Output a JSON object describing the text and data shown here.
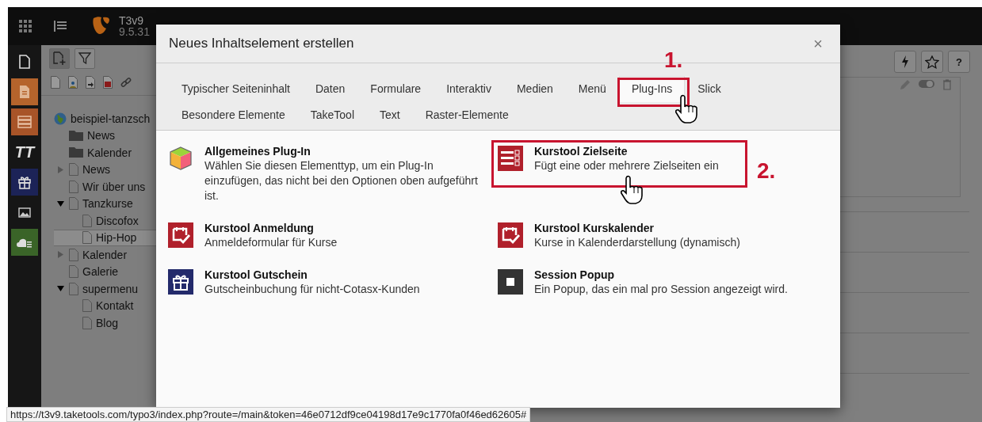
{
  "topbar": {
    "app_name": "T3v9",
    "version": "9.5.31"
  },
  "module_menu": [
    {
      "kind": "page"
    },
    {
      "kind": "content",
      "color": "#b5642c"
    },
    {
      "kind": "list",
      "color": "#a85428"
    },
    {
      "kind": "logo",
      "label": "TT"
    },
    {
      "kind": "gift",
      "color": "#1c2357"
    },
    {
      "kind": "image"
    },
    {
      "kind": "cloud",
      "color": "#3a6428"
    }
  ],
  "page_tree": {
    "root": {
      "label": "beispiel-tanzsch",
      "children": [
        {
          "label": "News",
          "kind": "folder",
          "selected": false
        },
        {
          "label": "Kalender",
          "kind": "folder",
          "selected": false
        },
        {
          "label": "News",
          "kind": "page",
          "selected": false,
          "expanded": false
        },
        {
          "label": "Wir über uns",
          "kind": "page",
          "selected": false
        },
        {
          "label": "Tanzkurse",
          "kind": "page",
          "selected": false,
          "expanded": true,
          "children": [
            {
              "label": "Discofox",
              "kind": "page",
              "selected": false
            },
            {
              "label": "Hip-Hop",
              "kind": "page",
              "selected": true
            }
          ]
        },
        {
          "label": "Kalender",
          "kind": "page",
          "selected": false,
          "expanded": false
        },
        {
          "label": "Galerie",
          "kind": "page",
          "selected": false
        },
        {
          "label": "supermenu",
          "kind": "page",
          "selected": false,
          "expanded": true,
          "children": [
            {
              "label": "Kontakt",
              "kind": "page",
              "selected": false
            },
            {
              "label": "Blog",
              "kind": "page",
              "selected": false
            }
          ]
        }
      ]
    }
  },
  "toolbar": {
    "help_label": "?"
  },
  "modal": {
    "title": "Neues Inhaltselement erstellen",
    "close": "×",
    "tab_rows": [
      {
        "tabs": [
          {
            "label": "Typischer Seiteninhalt",
            "selected": false
          },
          {
            "label": "Daten",
            "selected": false
          },
          {
            "label": "Formulare",
            "selected": false
          },
          {
            "label": "Interaktiv",
            "selected": false
          },
          {
            "label": "Medien",
            "selected": false
          },
          {
            "label": "Menü",
            "selected": false
          },
          {
            "label": "Plug-Ins",
            "selected": true
          },
          {
            "label": "Slick",
            "selected": false
          }
        ]
      },
      {
        "tabs": [
          {
            "label": "Besondere Elemente",
            "selected": false
          },
          {
            "label": "TakeTool",
            "selected": false
          },
          {
            "label": "Text",
            "selected": false
          },
          {
            "label": "Raster-Elemente",
            "selected": false
          }
        ]
      }
    ],
    "elements": [
      {
        "kind": "cube",
        "title": "Allgemeines Plug-In",
        "description": "Wählen Sie diesen Elementtyp, um ein Plug-In einzufügen, das nicht bei den Optionen oben aufgeführt ist."
      },
      {
        "kind": "list",
        "title": "Kurstool Zielseite",
        "description": "Fügt eine oder mehrere Zielseiten ein"
      },
      {
        "kind": "check",
        "title": "Kurstool Anmeldung",
        "description": "Anmeldeformular für Kurse"
      },
      {
        "kind": "check",
        "title": "Kurstool Kurskalender",
        "description": "Kurse in Kalenderdarstellung (dynamisch)"
      },
      {
        "kind": "gift",
        "title": "Kurstool Gutschein",
        "description": "Gutscheinbuchung für nicht-Cotasx-Kunden"
      },
      {
        "kind": "square",
        "title": "Session Popup",
        "description": "Ein Popup, das ein mal pro Session angezeigt wird."
      }
    ]
  },
  "annotations": [
    {
      "label": "1."
    },
    {
      "label": "2."
    }
  ],
  "status_url": "https://t3v9.taketools.com/typo3/index.php?route=/main&token=46e0712df9ce04198d17e9c1770fa0f46ed62605#"
}
